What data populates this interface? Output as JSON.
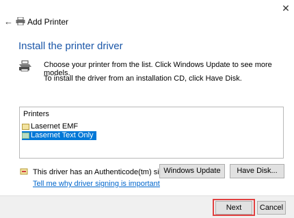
{
  "window": {
    "title": "Add Printer"
  },
  "heading": "Install the printer driver",
  "description": {
    "line1": "Choose your printer from the list. Click Windows Update to see more models.",
    "line2": "To install the driver from an installation CD, click Have Disk."
  },
  "printers": {
    "header": "Printers",
    "items": [
      {
        "label": "Lasernet EMF",
        "selected": false
      },
      {
        "label": "Lasernet Text Only",
        "selected": true
      }
    ]
  },
  "buttons": {
    "windows_update": "Windows Update",
    "have_disk": "Have Disk...",
    "next": "Next",
    "cancel": "Cancel"
  },
  "signature": {
    "text": "This driver has an Authenticode(tm) signature.",
    "link": "Tell me why driver signing is important"
  },
  "icons": {
    "close": "close-icon",
    "back": "back-arrow-icon",
    "printer": "printer-icon",
    "driver_folder": "driver-folder-icon",
    "signature": "signature-icon"
  },
  "colors": {
    "heading": "#1a56a8",
    "selection": "#0078d7",
    "link": "#0066cc",
    "highlight": "#e04040"
  }
}
